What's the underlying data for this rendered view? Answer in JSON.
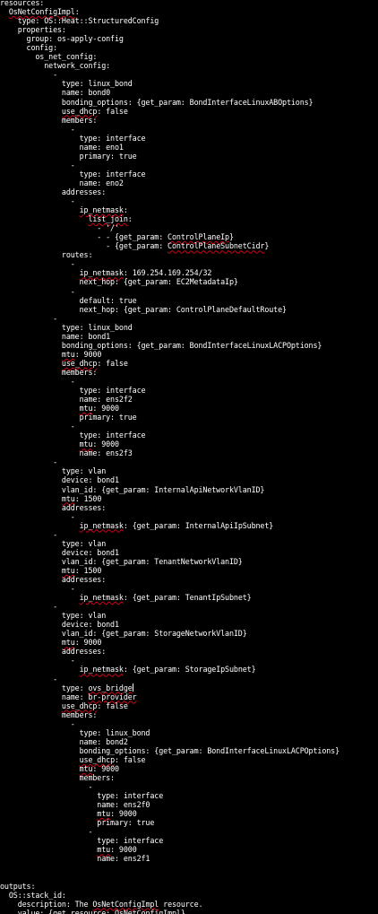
{
  "terminal": {
    "background": "#000000",
    "foreground": "#ffffff",
    "spell_underline_color": "#d0021b",
    "lines": [
      [
        {
          "t": "resources:"
        }
      ],
      [
        {
          "t": "  "
        },
        {
          "t": "OsNetConfigImpl",
          "s": 1
        },
        {
          "t": ":"
        }
      ],
      [
        {
          "t": "    type: OS::Heat::StructuredConfig"
        }
      ],
      [
        {
          "t": "    properties:"
        }
      ],
      [
        {
          "t": "      group: os-apply-config"
        }
      ],
      [
        {
          "t": "      config:"
        }
      ],
      [
        {
          "t": "        os_net_config:"
        }
      ],
      [
        {
          "t": "          network_config:"
        }
      ],
      [
        {
          "t": "            -"
        }
      ],
      [
        {
          "t": "              type: linux_bond"
        }
      ],
      [
        {
          "t": "              name: bond0"
        }
      ],
      [
        {
          "t": "              bonding_options: {get_param: BondInterfaceLinuxABOptions}"
        }
      ],
      [
        {
          "t": "              "
        },
        {
          "t": "use_dhcp",
          "s": 1
        },
        {
          "t": ": false"
        }
      ],
      [
        {
          "t": "              members:"
        }
      ],
      [
        {
          "t": "                -"
        }
      ],
      [
        {
          "t": "                  type: interface"
        }
      ],
      [
        {
          "t": "                  name: eno1"
        }
      ],
      [
        {
          "t": "                  primary: true"
        }
      ],
      [
        {
          "t": "                -"
        }
      ],
      [
        {
          "t": "                  type: interface"
        }
      ],
      [
        {
          "t": "                  name: eno2"
        }
      ],
      [
        {
          "t": "              addresses:"
        }
      ],
      [
        {
          "t": "                -"
        }
      ],
      [
        {
          "t": "                  "
        },
        {
          "t": "ip_netmask",
          "s": 1
        },
        {
          "t": ":"
        }
      ],
      [
        {
          "t": "                    "
        },
        {
          "t": "list_join",
          "s": 1
        },
        {
          "t": ":"
        }
      ],
      [
        {
          "t": "                      - '/'"
        }
      ],
      [
        {
          "t": "                      - - {get_param: "
        },
        {
          "t": "ControlPlaneIp",
          "s": 1
        },
        {
          "t": "}"
        }
      ],
      [
        {
          "t": "                        - {get_param: "
        },
        {
          "t": "ControlPlaneSubnetCidr",
          "s": 1
        },
        {
          "t": "}"
        }
      ],
      [
        {
          "t": "              routes:"
        }
      ],
      [
        {
          "t": "                -"
        }
      ],
      [
        {
          "t": "                  "
        },
        {
          "t": "ip_netmask",
          "s": 1
        },
        {
          "t": ": 169.254.169.254/32"
        }
      ],
      [
        {
          "t": "                  next_hop: {get_param: EC2MetadataIp}"
        }
      ],
      [
        {
          "t": "                -"
        }
      ],
      [
        {
          "t": "                  default: true"
        }
      ],
      [
        {
          "t": "                  next_hop: {get_param: ControlPlaneDefaultRoute}"
        }
      ],
      [
        {
          "t": "            -"
        }
      ],
      [
        {
          "t": "              type: linux_bond"
        }
      ],
      [
        {
          "t": "              name: bond1"
        }
      ],
      [
        {
          "t": "              bonding_options: {get_param: BondInterfaceLinuxLACPOptions}"
        }
      ],
      [
        {
          "t": "              "
        },
        {
          "t": "mtu",
          "s": 1
        },
        {
          "t": ": 9000"
        }
      ],
      [
        {
          "t": "              "
        },
        {
          "t": "use_dhcp",
          "s": 1
        },
        {
          "t": ": false"
        }
      ],
      [
        {
          "t": "              members:"
        }
      ],
      [
        {
          "t": "                -"
        }
      ],
      [
        {
          "t": "                  type: interface"
        }
      ],
      [
        {
          "t": "                  name: ens2f2"
        }
      ],
      [
        {
          "t": "                  "
        },
        {
          "t": "mtu",
          "s": 1
        },
        {
          "t": ": 9000"
        }
      ],
      [
        {
          "t": "                  primary: true"
        }
      ],
      [
        {
          "t": "                -"
        }
      ],
      [
        {
          "t": "                  type: interface"
        }
      ],
      [
        {
          "t": "                  "
        },
        {
          "t": "mtu",
          "s": 1
        },
        {
          "t": ": 9000"
        }
      ],
      [
        {
          "t": "                  name: ens2f3"
        }
      ],
      [
        {
          "t": "            -"
        }
      ],
      [
        {
          "t": "              type: vlan"
        }
      ],
      [
        {
          "t": "              device: bond1"
        }
      ],
      [
        {
          "t": "              vlan_id: {get_param: InternalApiNetworkVlanID}"
        }
      ],
      [
        {
          "t": "              "
        },
        {
          "t": "mtu",
          "s": 1
        },
        {
          "t": ": 1500"
        }
      ],
      [
        {
          "t": "              addresses:"
        }
      ],
      [
        {
          "t": "                -"
        }
      ],
      [
        {
          "t": "                  "
        },
        {
          "t": "ip_netmask",
          "s": 1
        },
        {
          "t": ": {get_param: InternalApiIpSubnet}"
        }
      ],
      [
        {
          "t": "            -"
        }
      ],
      [
        {
          "t": "              type: vlan"
        }
      ],
      [
        {
          "t": "              device: bond1"
        }
      ],
      [
        {
          "t": "              vlan_id: {get_param: TenantNetworkVlanID}"
        }
      ],
      [
        {
          "t": "              "
        },
        {
          "t": "mtu",
          "s": 1
        },
        {
          "t": ": 1500"
        }
      ],
      [
        {
          "t": "              addresses:"
        }
      ],
      [
        {
          "t": "                -"
        }
      ],
      [
        {
          "t": "                  "
        },
        {
          "t": "ip_netmask",
          "s": 1
        },
        {
          "t": ": {get_param: TenantIpSubnet}"
        }
      ],
      [
        {
          "t": "            -"
        }
      ],
      [
        {
          "t": "              type: vlan"
        }
      ],
      [
        {
          "t": "              device: bond1"
        }
      ],
      [
        {
          "t": "              vlan_id: {get_param: StorageNetworkVlanID}"
        }
      ],
      [
        {
          "t": "              "
        },
        {
          "t": "mtu",
          "s": 1
        },
        {
          "t": ": 9000"
        }
      ],
      [
        {
          "t": "              addresses:"
        }
      ],
      [
        {
          "t": "                -"
        }
      ],
      [
        {
          "t": "                  "
        },
        {
          "t": "ip_netmask",
          "s": 1
        },
        {
          "t": ": {get_param: StorageIpSubnet}"
        }
      ],
      [
        {
          "t": "            -"
        }
      ],
      [
        {
          "t": "              type: "
        },
        {
          "t": "ovs_bridge",
          "s": 1
        },
        {
          "c": 1
        }
      ],
      [
        {
          "t": "              name: "
        },
        {
          "t": "br-provider",
          "s": 1
        }
      ],
      [
        {
          "t": "              "
        },
        {
          "t": "use_dhcp",
          "s": 1
        },
        {
          "t": ": false"
        }
      ],
      [
        {
          "t": "              members:"
        }
      ],
      [
        {
          "t": "                -"
        }
      ],
      [
        {
          "t": "                  type: linux_bond"
        }
      ],
      [
        {
          "t": "                  name: bond2"
        }
      ],
      [
        {
          "t": "                  bonding_options: {get_param: BondInterfaceLinuxLACPOptions}"
        }
      ],
      [
        {
          "t": "                  "
        },
        {
          "t": "use_dhcp",
          "s": 1
        },
        {
          "t": ": false"
        }
      ],
      [
        {
          "t": "                  "
        },
        {
          "t": "mtu",
          "s": 1
        },
        {
          "t": ": 9000"
        }
      ],
      [
        {
          "t": "                  members:"
        }
      ],
      [
        {
          "t": "                    -"
        }
      ],
      [
        {
          "t": "                      type: interface"
        }
      ],
      [
        {
          "t": "                      name: ens2f0"
        }
      ],
      [
        {
          "t": "                      "
        },
        {
          "t": "mtu",
          "s": 1
        },
        {
          "t": ": 9000"
        }
      ],
      [
        {
          "t": "                      primary: true"
        }
      ],
      [
        {
          "t": "                    -"
        }
      ],
      [
        {
          "t": "                      type: interface"
        }
      ],
      [
        {
          "t": "                      "
        },
        {
          "t": "mtu",
          "s": 1
        },
        {
          "t": ": 9000"
        }
      ],
      [
        {
          "t": "                      name: ens2f1"
        }
      ],
      [
        {
          "t": ""
        }
      ],
      [
        {
          "t": ""
        }
      ],
      [
        {
          "t": "outputs:"
        }
      ],
      [
        {
          "t": "  OS::stack_id:"
        }
      ],
      [
        {
          "t": "    description: The "
        },
        {
          "t": "OsNetConfigImpl",
          "s": 1
        },
        {
          "t": " resource."
        }
      ],
      [
        {
          "t": "    value: {"
        },
        {
          "t": "get_resource",
          "s": 1
        },
        {
          "t": ": "
        },
        {
          "t": "OsNetConfigImpl",
          "s": 1
        },
        {
          "t": "}"
        }
      ]
    ]
  }
}
